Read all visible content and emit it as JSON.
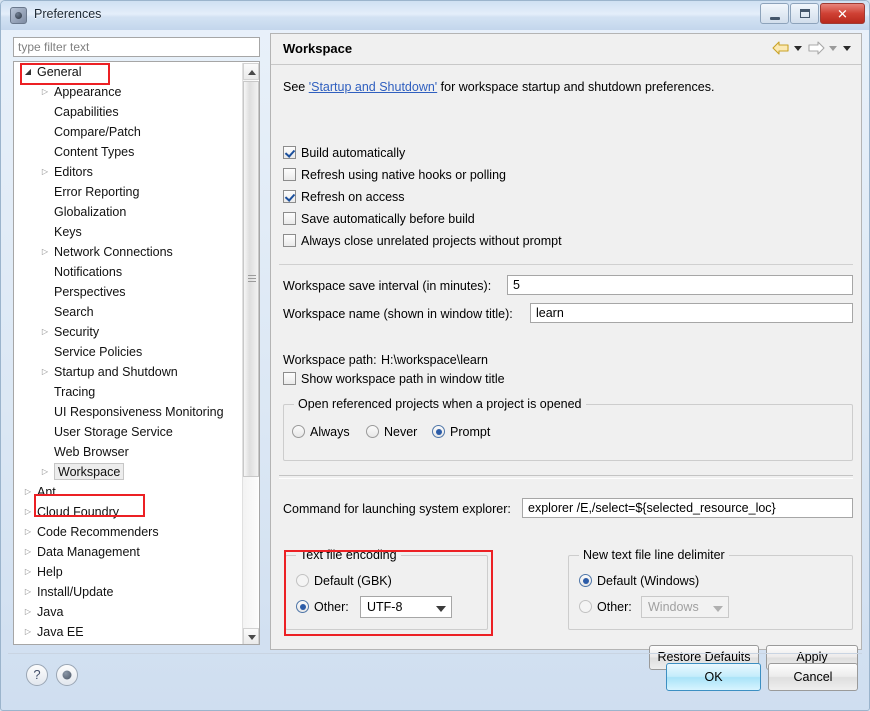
{
  "window": {
    "title": "Preferences",
    "icon": "preferences-icon",
    "controls": {
      "minimize": "minimize-button",
      "maximize": "maximize-button",
      "close_label": "✕"
    }
  },
  "sidebar": {
    "filter_placeholder": "type filter text",
    "filter_value": "",
    "items": [
      {
        "label": "General",
        "indent": 0,
        "arrow": "open",
        "selected": false,
        "highlighted": true
      },
      {
        "label": "Appearance",
        "indent": 1,
        "arrow": "closed",
        "selected": false,
        "highlighted": false
      },
      {
        "label": "Capabilities",
        "indent": 1,
        "arrow": "none",
        "selected": false,
        "highlighted": false
      },
      {
        "label": "Compare/Patch",
        "indent": 1,
        "arrow": "none",
        "selected": false,
        "highlighted": false
      },
      {
        "label": "Content Types",
        "indent": 1,
        "arrow": "none",
        "selected": false,
        "highlighted": false
      },
      {
        "label": "Editors",
        "indent": 1,
        "arrow": "closed",
        "selected": false,
        "highlighted": false
      },
      {
        "label": "Error Reporting",
        "indent": 1,
        "arrow": "none",
        "selected": false,
        "highlighted": false
      },
      {
        "label": "Globalization",
        "indent": 1,
        "arrow": "none",
        "selected": false,
        "highlighted": false
      },
      {
        "label": "Keys",
        "indent": 1,
        "arrow": "none",
        "selected": false,
        "highlighted": false
      },
      {
        "label": "Network Connections",
        "indent": 1,
        "arrow": "closed",
        "selected": false,
        "highlighted": false
      },
      {
        "label": "Notifications",
        "indent": 1,
        "arrow": "none",
        "selected": false,
        "highlighted": false
      },
      {
        "label": "Perspectives",
        "indent": 1,
        "arrow": "none",
        "selected": false,
        "highlighted": false
      },
      {
        "label": "Search",
        "indent": 1,
        "arrow": "none",
        "selected": false,
        "highlighted": false
      },
      {
        "label": "Security",
        "indent": 1,
        "arrow": "closed",
        "selected": false,
        "highlighted": false
      },
      {
        "label": "Service Policies",
        "indent": 1,
        "arrow": "none",
        "selected": false,
        "highlighted": false
      },
      {
        "label": "Startup and Shutdown",
        "indent": 1,
        "arrow": "closed",
        "selected": false,
        "highlighted": false
      },
      {
        "label": "Tracing",
        "indent": 1,
        "arrow": "none",
        "selected": false,
        "highlighted": false
      },
      {
        "label": "UI Responsiveness Monitoring",
        "indent": 1,
        "arrow": "none",
        "selected": false,
        "highlighted": false
      },
      {
        "label": "User Storage Service",
        "indent": 1,
        "arrow": "none",
        "selected": false,
        "highlighted": false
      },
      {
        "label": "Web Browser",
        "indent": 1,
        "arrow": "none",
        "selected": false,
        "highlighted": false
      },
      {
        "label": "Workspace",
        "indent": 1,
        "arrow": "closed",
        "selected": true,
        "highlighted": true
      },
      {
        "label": "Ant",
        "indent": 0,
        "arrow": "closed",
        "selected": false,
        "highlighted": false
      },
      {
        "label": "Cloud Foundry",
        "indent": 0,
        "arrow": "closed",
        "selected": false,
        "highlighted": false
      },
      {
        "label": "Code Recommenders",
        "indent": 0,
        "arrow": "closed",
        "selected": false,
        "highlighted": false
      },
      {
        "label": "Data Management",
        "indent": 0,
        "arrow": "closed",
        "selected": false,
        "highlighted": false
      },
      {
        "label": "Help",
        "indent": 0,
        "arrow": "closed",
        "selected": false,
        "highlighted": false
      },
      {
        "label": "Install/Update",
        "indent": 0,
        "arrow": "closed",
        "selected": false,
        "highlighted": false
      },
      {
        "label": "Java",
        "indent": 0,
        "arrow": "closed",
        "selected": false,
        "highlighted": false
      },
      {
        "label": "Java EE",
        "indent": 0,
        "arrow": "closed",
        "selected": false,
        "highlighted": false
      }
    ]
  },
  "page": {
    "title": "Workspace",
    "nav": {
      "back_icon": "back-arrow-icon",
      "back_menu_icon": "chevron-down-icon",
      "forward_icon": "forward-arrow-icon",
      "forward_menu_icon": "chevron-down-icon",
      "menu_icon": "chevron-down-icon"
    },
    "intro": {
      "before": "See ",
      "link": "'Startup and Shutdown'",
      "after": " for workspace startup and shutdown preferences."
    },
    "checkboxes": [
      {
        "label": "Build automatically",
        "checked": true
      },
      {
        "label": "Refresh using native hooks or polling",
        "checked": false
      },
      {
        "label": "Refresh on access",
        "checked": true
      },
      {
        "label": "Save automatically before build",
        "checked": false
      },
      {
        "label": "Always close unrelated projects without prompt",
        "checked": false
      }
    ],
    "save_interval": {
      "label": "Workspace save interval (in minutes):",
      "value": "5"
    },
    "workspace_name": {
      "label": "Workspace name (shown in window title):",
      "value": "learn"
    },
    "workspace_path": {
      "label": "Workspace path:",
      "value": "H:\\workspace\\learn"
    },
    "show_path": {
      "label": "Show workspace path in window title",
      "checked": false
    },
    "referenced": {
      "legend": "Open referenced projects when a project is opened",
      "options": [
        {
          "label": "Always",
          "selected": false
        },
        {
          "label": "Never",
          "selected": false
        },
        {
          "label": "Prompt",
          "selected": true
        }
      ]
    },
    "explorer_cmd": {
      "label": "Command for launching system explorer:",
      "value": "explorer /E,/select=${selected_resource_loc}"
    },
    "text_encoding": {
      "legend": "Text file encoding",
      "default_label": "Default (GBK)",
      "default_selected": false,
      "other_label": "Other:",
      "other_selected": true,
      "other_value": "UTF-8",
      "highlighted": true
    },
    "line_delimiter": {
      "legend": "New text file line delimiter",
      "default_label": "Default (Windows)",
      "default_selected": true,
      "other_label": "Other:",
      "other_selected": false,
      "other_value": "Windows",
      "other_disabled": true
    },
    "restore_defaults_label": "Restore Defaults",
    "apply_label": "Apply"
  },
  "footer": {
    "help_icon": "help-icon",
    "secondary_icon": "preferences-scope-icon",
    "ok_label": "OK",
    "cancel_label": "Cancel"
  },
  "colors": {
    "accent_highlight": "#ec2024",
    "link": "#2f5fbf",
    "default_button": "#a8e3f8",
    "close_button": "#cf4134"
  }
}
